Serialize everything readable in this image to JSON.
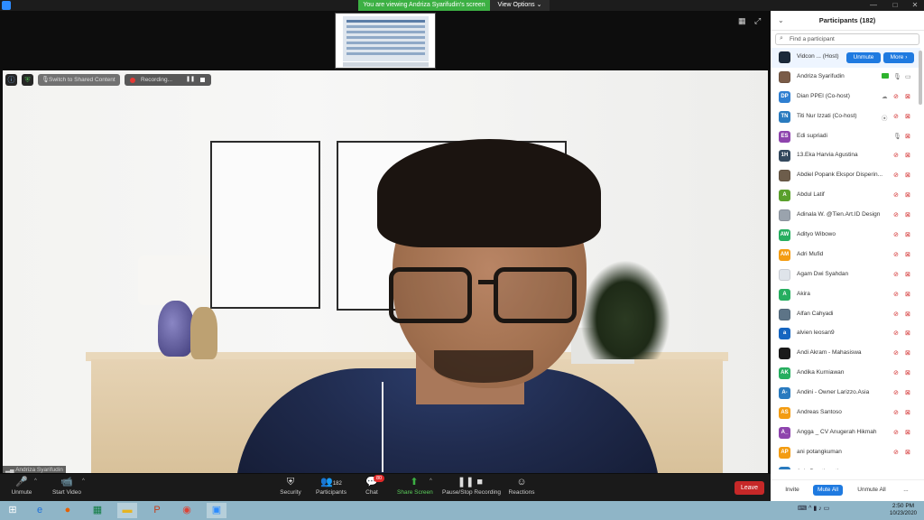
{
  "titlebar": {
    "share_banner": "You are viewing Andriza Syarifudin's screen",
    "view_options": "View Options ⌄",
    "minimize": "—",
    "maximize": "□",
    "close": "✕"
  },
  "video": {
    "switch_label": "Switch to Shared Content",
    "recording_label": "Recording...",
    "name_tag": "Andriza Syarifudin"
  },
  "toolbar": {
    "unmute": "Unmute",
    "start_video": "Start Video",
    "security": "Security",
    "participants": "Participants",
    "participants_count": "182",
    "chat": "Chat",
    "chat_badge": "80",
    "share_screen": "Share Screen",
    "pause_stop": "Pause/Stop Recording",
    "reactions": "Reactions",
    "leave": "Leave"
  },
  "panel": {
    "title": "Participants (182)",
    "search_placeholder": "Find a participant",
    "host_unmute": "Unmute",
    "host_more": "More ›",
    "participants": [
      {
        "name": "Vidcon ... (Host)",
        "initials": "",
        "color": "#1b2a3a"
      },
      {
        "name": "Andriza Syarifudin",
        "initials": "",
        "color": "#7a5c48"
      },
      {
        "name": "Dian PPEI (Co-host)",
        "initials": "DP",
        "color": "#2f7fd1"
      },
      {
        "name": "Titi Nur Izzati (Co-host)",
        "initials": "TN",
        "color": "#2a7bbf"
      },
      {
        "name": "Edi supriadi",
        "initials": "ES",
        "color": "#8e44ad"
      },
      {
        "name": "13.Eka Harvia Agustina",
        "initials": "1H",
        "color": "#34495e"
      },
      {
        "name": "Abdiel Popank Ekspor Disperin...",
        "initials": "",
        "color": "#6d5d4b"
      },
      {
        "name": "Abdul Latif",
        "initials": "A",
        "color": "#5aa02c"
      },
      {
        "name": "Adinala W. @Tien.Art.ID Design",
        "initials": "",
        "color": "#9aa3ad"
      },
      {
        "name": "Adityo Wibowo",
        "initials": "AW",
        "color": "#27ae60"
      },
      {
        "name": "Adri Mufid",
        "initials": "AM",
        "color": "#f39c12"
      },
      {
        "name": "Agam Dwi Syahdan",
        "initials": "",
        "color": "#dfe4ea"
      },
      {
        "name": "Akira",
        "initials": "A",
        "color": "#27ae60"
      },
      {
        "name": "Alfan Cahyadi",
        "initials": "",
        "color": "#5d7487"
      },
      {
        "name": "alvien leosan9",
        "initials": "a",
        "color": "#1565c0"
      },
      {
        "name": "Andi Akram - Mahasiswa",
        "initials": "",
        "color": "#1a1a1a"
      },
      {
        "name": "Andika Kurniawan",
        "initials": "AK",
        "color": "#27ae60"
      },
      {
        "name": "Andini - Owner Larizzo.Asia",
        "initials": "A-",
        "color": "#2a7bbf"
      },
      {
        "name": "Andreas Santoso",
        "initials": "AS",
        "color": "#f39c12"
      },
      {
        "name": "Angga _ CV Anugerah Hikmah",
        "initials": "A_",
        "color": "#8e44ad"
      },
      {
        "name": "ani potangkuman",
        "initials": "AP",
        "color": "#f39c12"
      },
      {
        "name": "Anis Prastiowati",
        "initials": "AP",
        "color": "#2a7bbf"
      }
    ],
    "invite": "Invite",
    "mute_all": "Mute All",
    "unmute_all": "Unmute All",
    "more_footer": "..."
  },
  "taskbar": {
    "time": "2:50 PM",
    "date": "10/23/2020"
  }
}
